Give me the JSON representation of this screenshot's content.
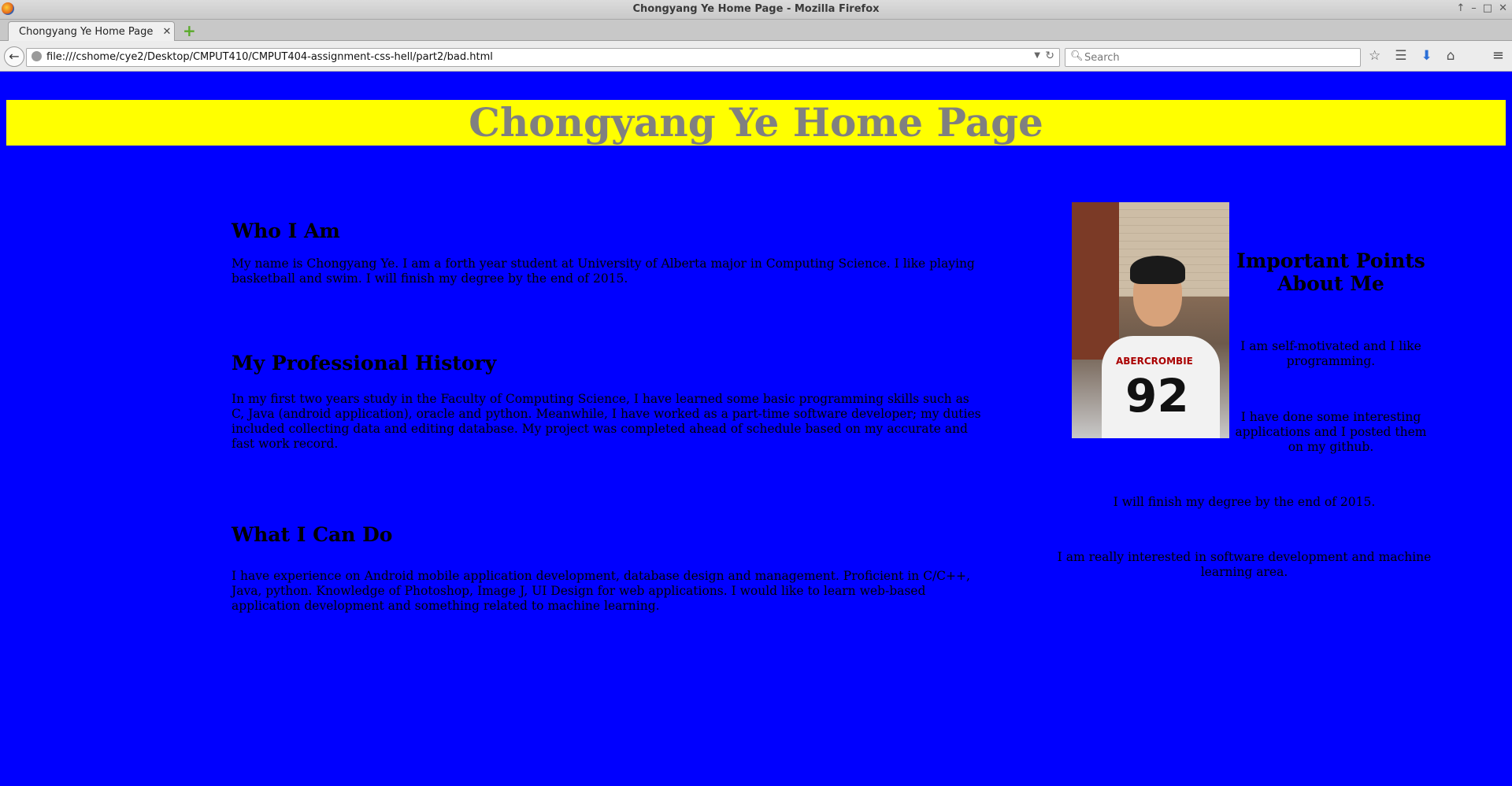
{
  "browser": {
    "window_title": "Chongyang Ye Home Page - Mozilla Firefox",
    "tab_label": "Chongyang Ye Home Page",
    "url": "file:///cshome/cye2/Desktop/CMPUT410/CMPUT404-assignment-css-hell/part2/bad.html",
    "search_placeholder": "Search"
  },
  "page": {
    "title": "Chongyang Ye Home Page",
    "sections": [
      {
        "heading": "Who I Am",
        "text": "My name is Chongyang Ye. I am a forth year student at University of Alberta major in Computing Science. I like playing basketball and swim. I will finish my degree by the end of 2015."
      },
      {
        "heading": "My Professional History",
        "text": "In my first two years study in the Faculty of Computing Science, I have learned some basic programming skills such as C, Java (android application), oracle and python. Meanwhile, I have worked as a part-time software developer; my duties included collecting data and editing database. My project was completed ahead of schedule based on my accurate and fast work record."
      },
      {
        "heading": "What I Can Do",
        "text": "I have experience on Android mobile application development, database design and management. Proficient in C/C++, Java, python. Knowledge of Photoshop, Image J, UI Design for web applications. I would like to learn web-based application development and something related to machine learning."
      }
    ],
    "aside": {
      "heading": "Important Points About Me",
      "points": [
        "I am self-motivated and I like programming.",
        "I have done some interesting applications and I posted them on my github.",
        "I will finish my degree by the end of 2015.",
        "I am really interested in software development and machine learning area."
      ],
      "photo_shirt_text": "ABERCROMBIE",
      "photo_shirt_number": "92"
    }
  },
  "colors": {
    "background": "#0000ff",
    "banner": "#ffff00",
    "banner_text": "#808080"
  }
}
